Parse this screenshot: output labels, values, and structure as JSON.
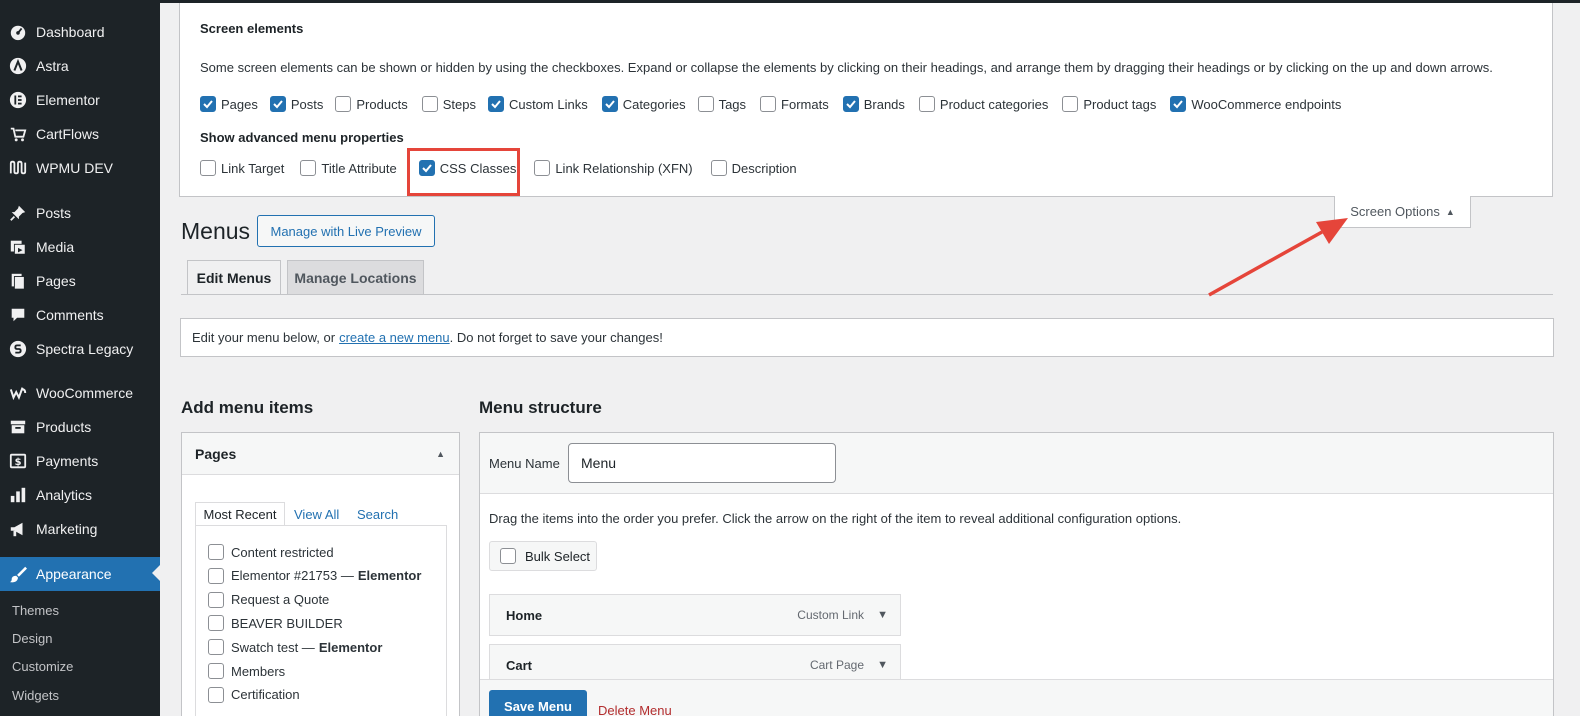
{
  "sidebar": {
    "items": [
      {
        "label": "Dashboard",
        "icon": "dashboard-icon"
      },
      {
        "label": "Astra",
        "icon": "astra-icon"
      },
      {
        "label": "Elementor",
        "icon": "elementor-icon"
      },
      {
        "label": "CartFlows",
        "icon": "cartflows-icon"
      },
      {
        "label": "WPMU DEV",
        "icon": "wpmudev-icon"
      },
      {
        "label": "Posts",
        "icon": "pin-icon"
      },
      {
        "label": "Media",
        "icon": "media-icon"
      },
      {
        "label": "Pages",
        "icon": "pages-icon"
      },
      {
        "label": "Comments",
        "icon": "comment-icon"
      },
      {
        "label": "Spectra Legacy",
        "icon": "spectra-icon"
      },
      {
        "label": "WooCommerce",
        "icon": "woocommerce-icon"
      },
      {
        "label": "Products",
        "icon": "archive-icon"
      },
      {
        "label": "Payments",
        "icon": "dollar-icon"
      },
      {
        "label": "Analytics",
        "icon": "bar-chart-icon"
      },
      {
        "label": "Marketing",
        "icon": "megaphone-icon"
      },
      {
        "label": "Appearance",
        "icon": "brush-icon"
      }
    ],
    "sub_items": [
      "Themes",
      "Design",
      "Customize",
      "Widgets"
    ]
  },
  "screen_options": {
    "title": "Screen elements",
    "description": "Some screen elements can be shown or hidden by using the checkboxes. Expand or collapse the elements by clicking on their headings, and arrange them by dragging their headings or by clicking on the up and down arrows.",
    "elements": [
      {
        "label": "Pages",
        "checked": true
      },
      {
        "label": "Posts",
        "checked": true
      },
      {
        "label": "Products",
        "checked": false
      },
      {
        "label": "Steps",
        "checked": false
      },
      {
        "label": "Custom Links",
        "checked": true
      },
      {
        "label": "Categories",
        "checked": true
      },
      {
        "label": "Tags",
        "checked": false
      },
      {
        "label": "Formats",
        "checked": false
      },
      {
        "label": "Brands",
        "checked": true
      },
      {
        "label": "Product categories",
        "checked": false
      },
      {
        "label": "Product tags",
        "checked": false
      },
      {
        "label": "WooCommerce endpoints",
        "checked": true
      }
    ],
    "advanced_title": "Show advanced menu properties",
    "advanced": [
      {
        "label": "Link Target",
        "checked": false
      },
      {
        "label": "Title Attribute",
        "checked": false
      },
      {
        "label": "CSS Classes",
        "checked": true
      },
      {
        "label": "Link Relationship (XFN)",
        "checked": false
      },
      {
        "label": "Description",
        "checked": false
      }
    ],
    "tab_label": "Screen Options"
  },
  "header": {
    "title": "Menus",
    "live_preview_label": "Manage with Live Preview",
    "tabs": [
      "Edit Menus",
      "Manage Locations"
    ]
  },
  "notice": {
    "before": "Edit your menu below, or",
    "link": "create a new menu",
    "after": ". Do not forget to save your changes!"
  },
  "add_items": {
    "heading": "Add menu items",
    "box_title": "Pages",
    "tabs": [
      "Most Recent",
      "View All",
      "Search"
    ],
    "pages": [
      {
        "label": "Content restricted",
        "suffix": ""
      },
      {
        "label": "Elementor #21753 —",
        "suffix": "Elementor"
      },
      {
        "label": "Request a Quote",
        "suffix": ""
      },
      {
        "label": "BEAVER BUILDER",
        "suffix": ""
      },
      {
        "label": "Swatch test —",
        "suffix": "Elementor"
      },
      {
        "label": "Members",
        "suffix": ""
      },
      {
        "label": "Certification",
        "suffix": ""
      }
    ]
  },
  "structure": {
    "heading": "Menu structure",
    "name_label": "Menu Name",
    "name_value": "Menu",
    "drag_hint": "Drag the items into the order you prefer. Click the arrow on the right of the item to reveal additional configuration options.",
    "bulk_label": "Bulk Select",
    "items": [
      {
        "label": "Home",
        "type": "Custom Link"
      },
      {
        "label": "Cart",
        "type": "Cart Page"
      }
    ],
    "save_label": "Save Menu",
    "delete_label": "Delete Menu"
  },
  "colors": {
    "accent": "#2271b1",
    "sidebar_bg": "#1d2327",
    "annotation_red": "#e5453a"
  }
}
